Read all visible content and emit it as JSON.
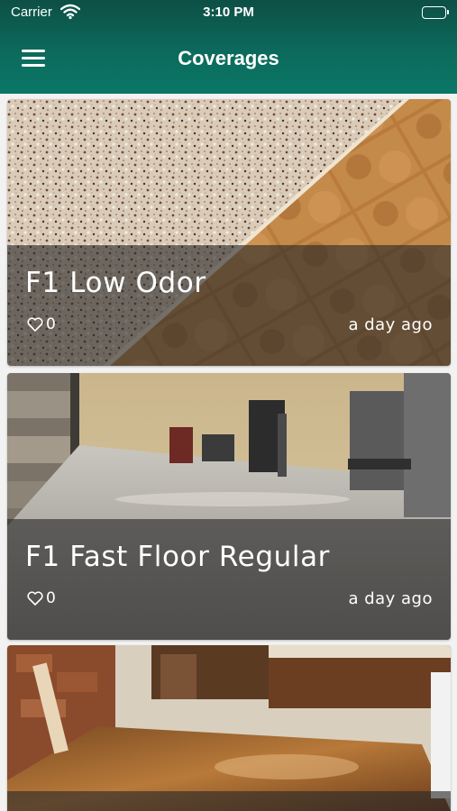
{
  "status_bar": {
    "carrier": "Carrier",
    "time": "3:10 PM",
    "icons": [
      "wifi-icon",
      "battery-icon"
    ]
  },
  "header": {
    "title": "Coverages",
    "menu_icon": "hamburger-menu-icon",
    "background_color": "#0c6a5c"
  },
  "cards": [
    {
      "title": "F1 Low Odor",
      "likes": "0",
      "time_ago": "a day ago"
    },
    {
      "title": "F1 Fast Floor Regular",
      "likes": "0",
      "time_ago": "a day ago"
    },
    {
      "title": "",
      "likes": "",
      "time_ago": ""
    }
  ]
}
